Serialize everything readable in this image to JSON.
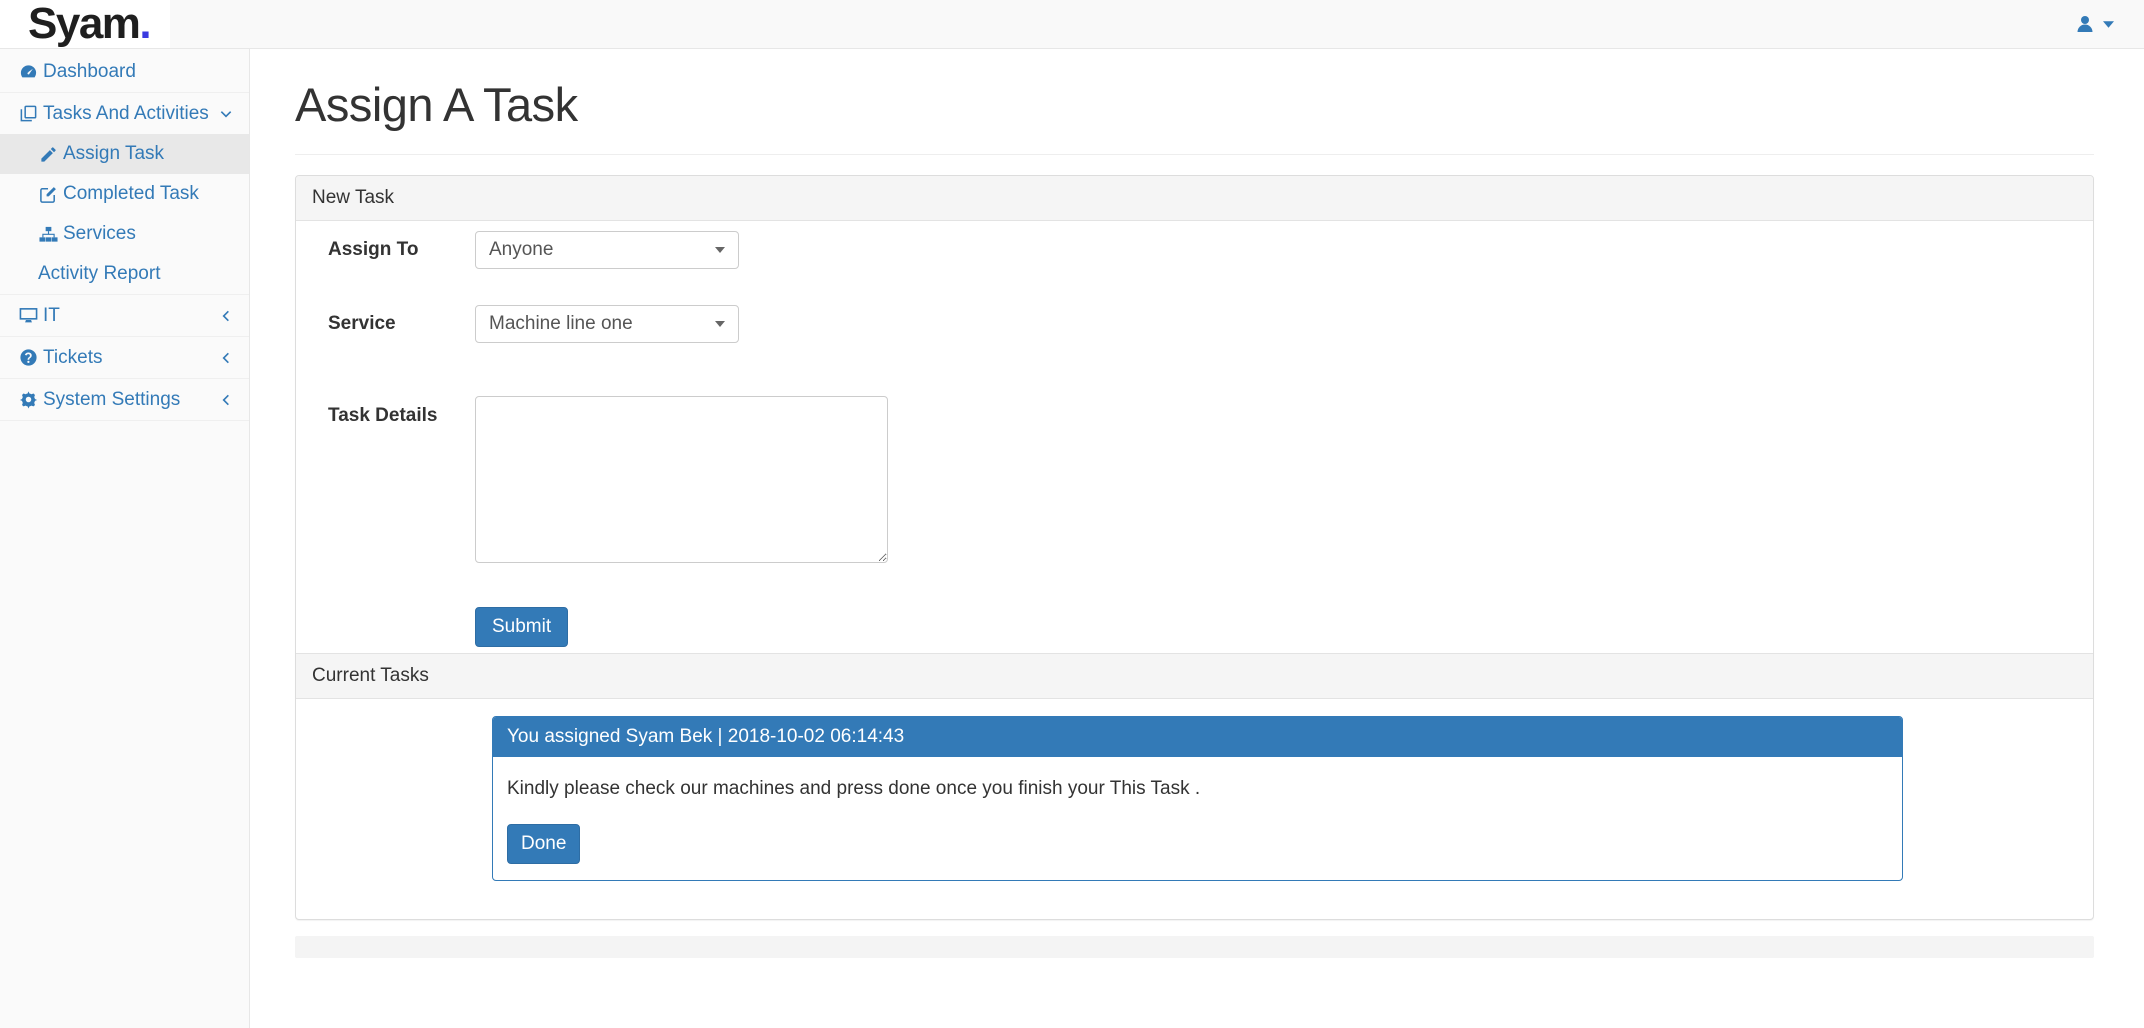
{
  "brand": {
    "name": "Syam",
    "dot": "."
  },
  "sidebar": {
    "items": [
      {
        "label": "Dashboard"
      },
      {
        "label": "Tasks And Activities"
      },
      {
        "label": "Assign Task"
      },
      {
        "label": "Completed Task"
      },
      {
        "label": "Services"
      },
      {
        "label": "Activity Report"
      },
      {
        "label": "IT"
      },
      {
        "label": "Tickets"
      },
      {
        "label": "System Settings"
      }
    ]
  },
  "page": {
    "title": "Assign A Task"
  },
  "new_task": {
    "heading": "New Task",
    "assign_to": {
      "label": "Assign To",
      "value": "Anyone"
    },
    "service": {
      "label": "Service",
      "value": "Machine line one"
    },
    "task_details": {
      "label": "Task Details",
      "value": ""
    },
    "submit_label": "Submit"
  },
  "current_tasks": {
    "heading": "Current Tasks",
    "tasks": [
      {
        "header": "You assigned Syam Bek | 2018-10-02 06:14:43",
        "details": "Kindly please check our machines and press done once you finish your This Task .",
        "action_label": "Done"
      }
    ]
  },
  "colors": {
    "primary": "#337ab7",
    "primary_border": "#2e6da4",
    "brand_dot": "#3a3ae0",
    "panel_heading_bg": "#f5f5f5",
    "sidebar_active_bg": "#e8e8e8"
  }
}
